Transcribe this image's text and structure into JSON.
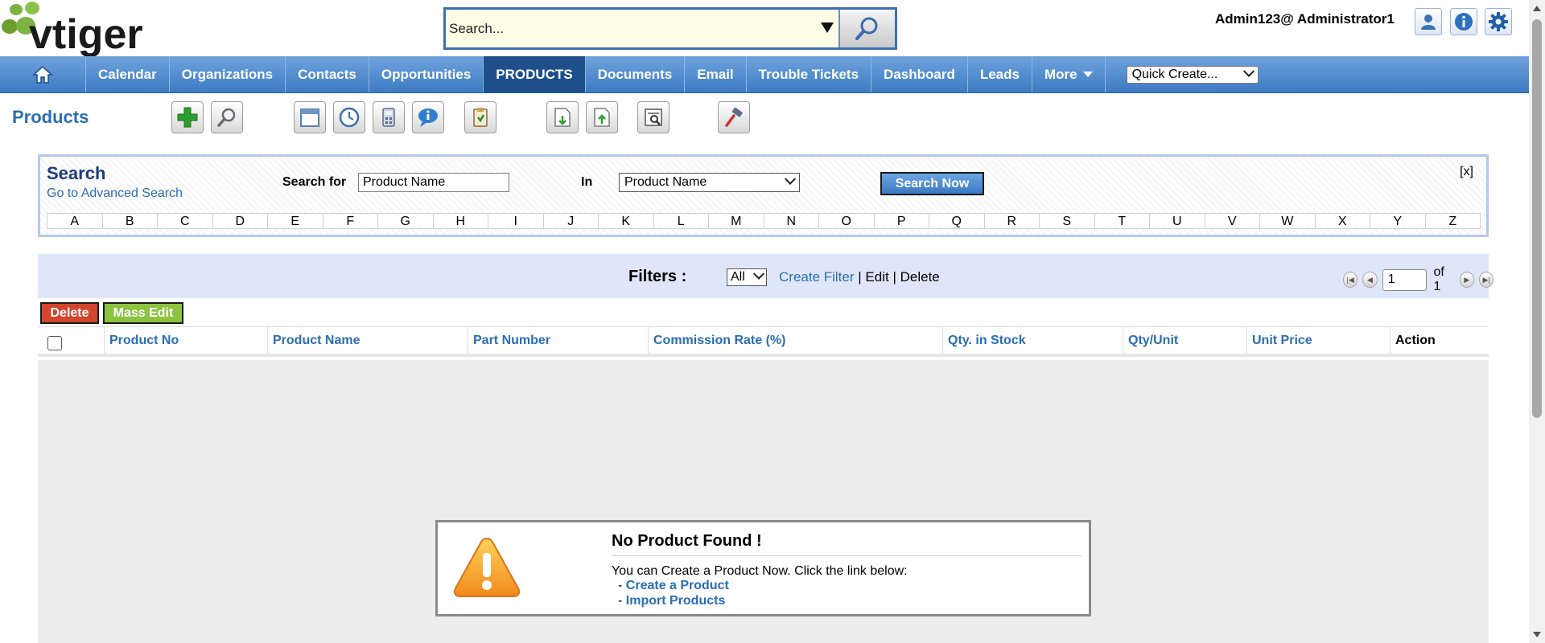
{
  "brand": {
    "logo_text": "vtiger"
  },
  "header": {
    "search_placeholder": "Search...",
    "user_label": "Admin123@ Administrator1",
    "icons": [
      "user-profile-icon",
      "info-icon",
      "settings-gear-icon"
    ]
  },
  "nav": {
    "tabs": [
      {
        "label": "Calendar"
      },
      {
        "label": "Organizations"
      },
      {
        "label": "Contacts"
      },
      {
        "label": "Opportunities"
      },
      {
        "label": "PRODUCTS"
      },
      {
        "label": "Documents"
      },
      {
        "label": "Email"
      },
      {
        "label": "Trouble Tickets"
      },
      {
        "label": "Dashboard"
      },
      {
        "label": "Leads"
      },
      {
        "label": "More"
      }
    ],
    "active_tab": "PRODUCTS",
    "quick_create": "Quick Create..."
  },
  "page": {
    "title": "Products"
  },
  "toolbar": {
    "icons": [
      "add-icon",
      "search-icon",
      "calendar-icon",
      "clock-icon",
      "calculator-icon",
      "chat-icon",
      "clipboard-icon",
      "import-icon",
      "export-icon",
      "find-duplicates-icon",
      "settings-hammer-icon"
    ]
  },
  "search_panel": {
    "title": "Search",
    "advanced_link": "Go to Advanced Search",
    "search_for_label": "Search for",
    "search_for_value": "Product Name",
    "in_label": "In",
    "in_value": "Product Name",
    "button": "Search Now",
    "close": "[x]",
    "alphabet": [
      "A",
      "B",
      "C",
      "D",
      "E",
      "F",
      "G",
      "H",
      "I",
      "J",
      "K",
      "L",
      "M",
      "N",
      "O",
      "P",
      "Q",
      "R",
      "S",
      "T",
      "U",
      "V",
      "W",
      "X",
      "Y",
      "Z"
    ]
  },
  "filters": {
    "label": "Filters :",
    "selected": "All",
    "create": "Create Filter",
    "sep": "|",
    "edit": "Edit",
    "delete": "Delete",
    "page_value": "1",
    "page_of": "of 1"
  },
  "actions": {
    "delete": "Delete",
    "mass_edit": "Mass Edit"
  },
  "table": {
    "columns": [
      "Product No",
      "Product Name",
      "Part Number",
      "Commission Rate (%)",
      "Qty. in Stock",
      "Qty/Unit",
      "Unit Price",
      "Action"
    ]
  },
  "empty": {
    "title": "No Product Found !",
    "message": "You can Create a Product Now. Click the link below:",
    "bullet": "-",
    "link1": "Create a Product",
    "link2": "Import Products"
  },
  "colors": {
    "nav_blue": "#3d7bc3",
    "active_tab": "#1f4f8a",
    "link_blue": "#2a6db3",
    "delete_red": "#d3452e",
    "mass_edit_green": "#8cc341",
    "filter_bg": "#e0e6fa"
  }
}
